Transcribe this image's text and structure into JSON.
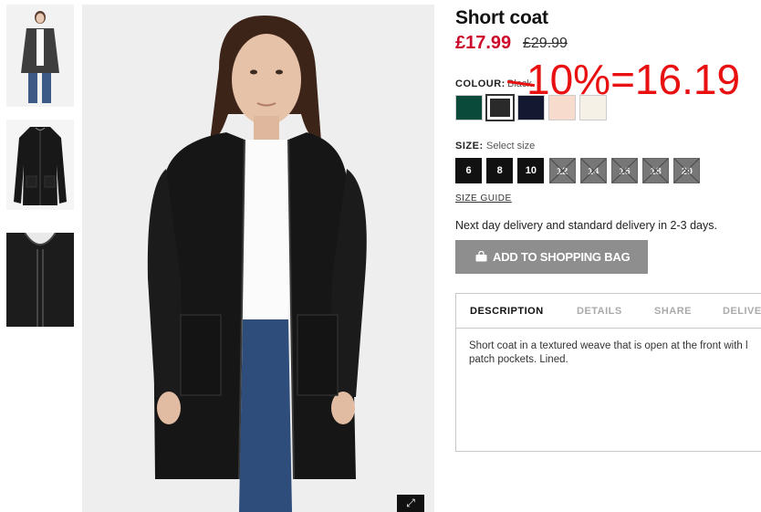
{
  "product": {
    "title": "Short coat",
    "sale_price": "£17.99",
    "original_price": "£29.99"
  },
  "annotation": {
    "text": "10%=16.19"
  },
  "colour": {
    "label": "COLOUR:",
    "value": "Black",
    "swatches": [
      {
        "name": "dark-green",
        "color": "#0a4a3a"
      },
      {
        "name": "black",
        "color": "#2a2a2a",
        "selected": true
      },
      {
        "name": "dark-navy",
        "color": "#141830"
      },
      {
        "name": "light-pink",
        "color": "#f7dccd"
      },
      {
        "name": "cream",
        "color": "#f6f1e6"
      }
    ]
  },
  "size": {
    "label": "SIZE:",
    "value": "Select size",
    "options": [
      {
        "label": "6",
        "available": true
      },
      {
        "label": "8",
        "available": true
      },
      {
        "label": "10",
        "available": true
      },
      {
        "label": "12",
        "available": false
      },
      {
        "label": "14",
        "available": false
      },
      {
        "label": "16",
        "available": false
      },
      {
        "label": "18",
        "available": false
      },
      {
        "label": "20",
        "available": false
      }
    ],
    "guide_label": "SIZE GUIDE"
  },
  "delivery_text": "Next day delivery and standard delivery in 2-3 days.",
  "add_to_bag": {
    "label": "ADD TO SHOPPING BAG",
    "icon": "shopping-bag-icon"
  },
  "tabs": [
    {
      "label": "DESCRIPTION",
      "active": true
    },
    {
      "label": "DETAILS",
      "active": false
    },
    {
      "label": "SHARE",
      "active": false
    },
    {
      "label": "DELIVE",
      "active": false
    }
  ],
  "description": "Short coat in a textured weave that is open at the front with l patch pockets. Lined.",
  "colors": {
    "sale": "#cc0a2b",
    "annotation": "#e81010",
    "button": "#8e8e8e"
  }
}
